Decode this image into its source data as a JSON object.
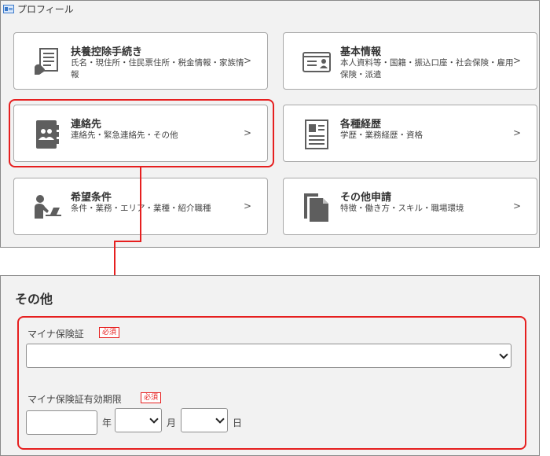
{
  "window": {
    "title": "プロフィール",
    "icon": "profile-card-icon"
  },
  "cards": [
    {
      "id": "fuyo",
      "title": "扶養控除手続き",
      "subtitle": "氏名・現住所・住民票住所・税金情報・家族情報",
      "chevron": ">",
      "icon": "tax-form-icon"
    },
    {
      "id": "kihon",
      "title": "基本情報",
      "subtitle": "本人資料等・国籍・振込口座・社会保険・雇用保険・派遣",
      "chevron": ">",
      "icon": "id-card-icon"
    },
    {
      "id": "renraku",
      "title": "連絡先",
      "subtitle": "連絡先・緊急連絡先・その他",
      "chevron": ">",
      "icon": "contact-book-icon"
    },
    {
      "id": "keireki",
      "title": "各種経歴",
      "subtitle": "学歴・業務経歴・資格",
      "chevron": ">",
      "icon": "resume-icon"
    },
    {
      "id": "kibou",
      "title": "希望条件",
      "subtitle": "条件・業務・エリア・業種・紹介職種",
      "chevron": ">",
      "icon": "person-desk-icon"
    },
    {
      "id": "sonota",
      "title": "その他申請",
      "subtitle": "特徴・働き方・スキル・職場環境",
      "chevron": ">",
      "icon": "documents-icon"
    }
  ],
  "section": {
    "title": "その他",
    "fields": {
      "insurance_card": {
        "label": "マイナ保険証",
        "required": "必須",
        "value": ""
      },
      "expiry": {
        "label": "マイナ保険証有効期限",
        "required": "必須",
        "year_value": "",
        "year_unit": "年",
        "month_value": "",
        "month_unit": "月",
        "day_value": "",
        "day_unit": "日"
      }
    }
  },
  "colors": {
    "highlight": "#e61f1f",
    "icon_gray": "#5e5e5e",
    "panel_bg": "#f2f2f2"
  }
}
